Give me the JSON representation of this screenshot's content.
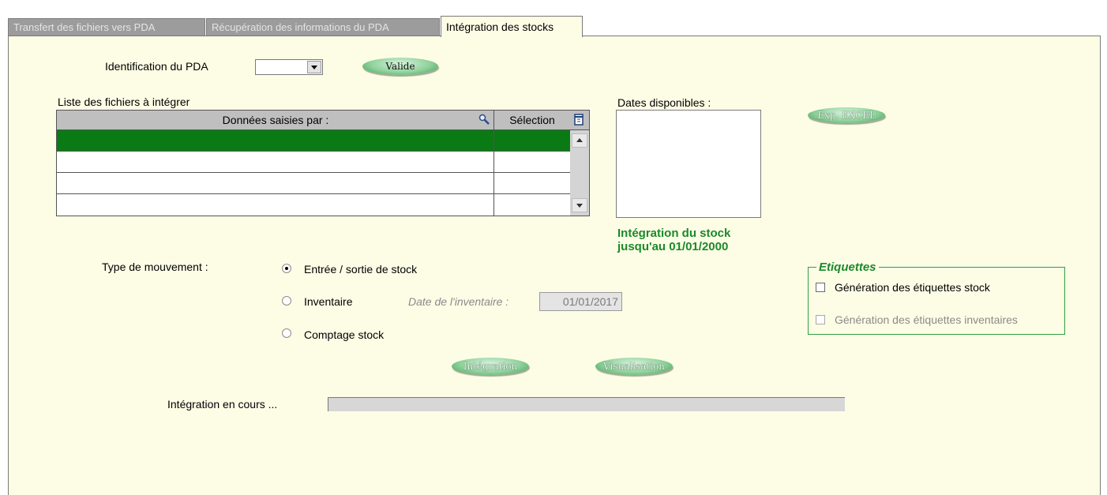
{
  "tabs": [
    {
      "label": "Transfert des fichiers vers PDA",
      "active": false
    },
    {
      "label": "Récupération des informations du PDA",
      "active": false
    },
    {
      "label": "Intégration des stocks",
      "active": true
    }
  ],
  "pda": {
    "label": "Identification du PDA",
    "value": "",
    "validate_button": "Valide"
  },
  "file_list": {
    "title": "Liste des fichiers à intégrer",
    "columns": [
      "Données saisies par :",
      "Sélection"
    ],
    "rows": [
      {
        "user": "",
        "selection": "",
        "selected": true
      },
      {
        "user": "",
        "selection": "",
        "selected": false
      },
      {
        "user": "",
        "selection": "",
        "selected": false
      },
      {
        "user": "",
        "selection": "",
        "selected": false
      }
    ]
  },
  "dates": {
    "label": "Dates disponibles :",
    "items": []
  },
  "export_button": "Exp. EXCEL",
  "integration_info": {
    "line1": "Intégration du stock",
    "line2": "jusqu'au 01/01/2000"
  },
  "movement": {
    "label": "Type de mouvement :",
    "options": [
      {
        "label": "Entrée / sortie de stock",
        "checked": true
      },
      {
        "label": "Inventaire",
        "checked": false
      },
      {
        "label": "Comptage stock",
        "checked": false
      }
    ],
    "inventory_date_label": "Date de l'inventaire :",
    "inventory_date_value": "01/01/2017"
  },
  "labels_group": {
    "title": "Etiquettes",
    "options": [
      {
        "label": "Génération des étiquettes stock",
        "checked": false,
        "enabled": true
      },
      {
        "label": "Génération des étiquettes inventaires",
        "checked": false,
        "enabled": false
      }
    ]
  },
  "actions": {
    "integrate": "Intégration",
    "visualize": "Visualisation"
  },
  "progress": {
    "label": "Intégration en cours ...",
    "value": 0
  },
  "colors": {
    "panel_bg": "#fdfde6",
    "selected_row": "#0a7a14",
    "accent_green": "#1a8a2a",
    "button_green": "#8fd29c"
  }
}
